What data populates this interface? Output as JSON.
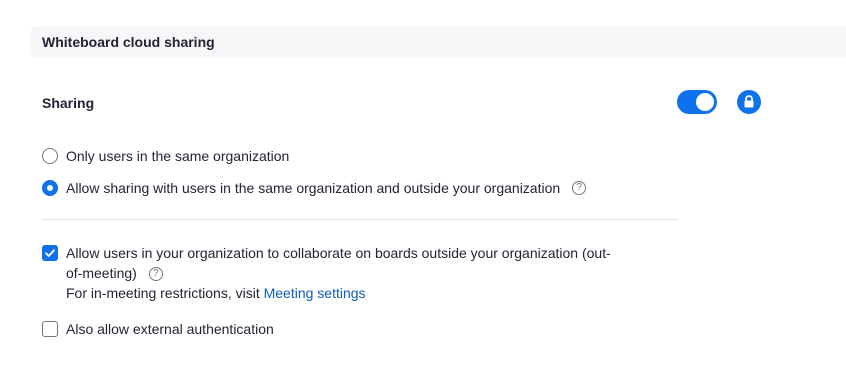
{
  "section": {
    "title": "Whiteboard cloud sharing"
  },
  "setting": {
    "title": "Sharing",
    "toggle_on": true,
    "locked": true
  },
  "radio_options": [
    {
      "label": "Only users in the same organization",
      "selected": false
    },
    {
      "label": "Allow sharing with users in the same organization and outside your organization",
      "selected": true,
      "help": "?"
    }
  ],
  "checkbox_options": {
    "collaborate": {
      "label_line1": "Allow users in your organization to collaborate on boards outside your organization (out-",
      "label_line2": "of-meeting)",
      "help": "?",
      "note_prefix": "For in-meeting restrictions, visit",
      "note_link": "Meeting settings",
      "checked": true
    },
    "external_auth": {
      "label": "Also allow external authentication",
      "checked": false
    }
  },
  "icons": {
    "toggle": "toggle-icon",
    "lock": "lock-icon",
    "help": "help-icon",
    "check": "checkmark-icon"
  },
  "colors": {
    "accent": "#0e72ed",
    "link": "#0e5bc1",
    "header_bg": "#f7f7fa",
    "divider": "#e4e4ed"
  }
}
